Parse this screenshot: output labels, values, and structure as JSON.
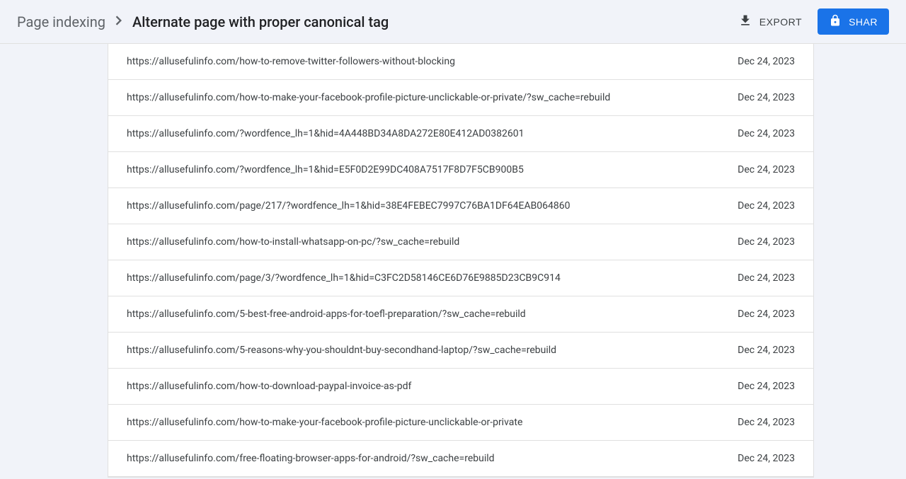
{
  "breadcrumb": {
    "prev": "Page indexing",
    "current": "Alternate page with proper canonical tag"
  },
  "header": {
    "export_label": "EXPORT",
    "share_label": "SHAR"
  },
  "rows": [
    {
      "url": "https://allusefulinfo.com/how-to-remove-twitter-followers-without-blocking",
      "date": "Dec 24, 2023"
    },
    {
      "url": "https://allusefulinfo.com/how-to-make-your-facebook-profile-picture-unclickable-or-private/?sw_cache=rebuild",
      "date": "Dec 24, 2023"
    },
    {
      "url": "https://allusefulinfo.com/?wordfence_lh=1&hid=4A448BD34A8DA272E80E412AD0382601",
      "date": "Dec 24, 2023"
    },
    {
      "url": "https://allusefulinfo.com/?wordfence_lh=1&hid=E5F0D2E99DC408A7517F8D7F5CB900B5",
      "date": "Dec 24, 2023"
    },
    {
      "url": "https://allusefulinfo.com/page/217/?wordfence_lh=1&hid=38E4FEBEC7997C76BA1DF64EAB064860",
      "date": "Dec 24, 2023"
    },
    {
      "url": "https://allusefulinfo.com/how-to-install-whatsapp-on-pc/?sw_cache=rebuild",
      "date": "Dec 24, 2023"
    },
    {
      "url": "https://allusefulinfo.com/page/3/?wordfence_lh=1&hid=C3FC2D58146CE6D76E9885D23CB9C914",
      "date": "Dec 24, 2023"
    },
    {
      "url": "https://allusefulinfo.com/5-best-free-android-apps-for-toefl-preparation/?sw_cache=rebuild",
      "date": "Dec 24, 2023"
    },
    {
      "url": "https://allusefulinfo.com/5-reasons-why-you-shouldnt-buy-secondhand-laptop/?sw_cache=rebuild",
      "date": "Dec 24, 2023"
    },
    {
      "url": "https://allusefulinfo.com/how-to-download-paypal-invoice-as-pdf",
      "date": "Dec 24, 2023"
    },
    {
      "url": "https://allusefulinfo.com/how-to-make-your-facebook-profile-picture-unclickable-or-private",
      "date": "Dec 24, 2023"
    },
    {
      "url": "https://allusefulinfo.com/free-floating-browser-apps-for-android/?sw_cache=rebuild",
      "date": "Dec 24, 2023"
    }
  ]
}
